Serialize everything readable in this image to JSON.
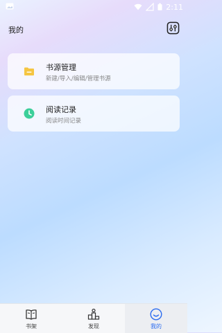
{
  "status": {
    "time": "2:11"
  },
  "header": {
    "title": "我的",
    "settings_icon": "settings-sliders-icon"
  },
  "cards": [
    {
      "title": "书源管理",
      "subtitle": "新建/导入/编辑/管理书源",
      "icon": "folder-icon",
      "icon_color": "#f5c542"
    },
    {
      "title": "阅读记录",
      "subtitle": "阅读时间记录",
      "icon": "clock-icon",
      "icon_color": "#3ccf9a"
    }
  ],
  "tabs": [
    {
      "label": "书架",
      "icon": "book-icon",
      "active": false
    },
    {
      "label": "发现",
      "icon": "podium-icon",
      "active": false
    },
    {
      "label": "我的",
      "icon": "smile-icon",
      "active": true
    }
  ],
  "colors": {
    "accent": "#2b6cf0"
  }
}
